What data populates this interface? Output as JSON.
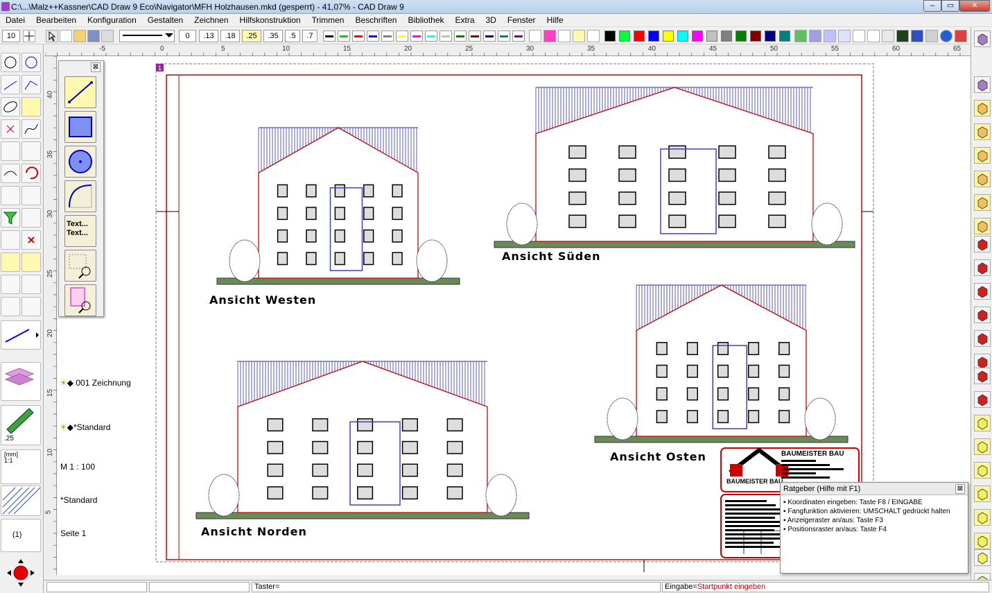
{
  "window": {
    "title": "C:\\...\\Malz++Kassner\\CAD Draw 9 Eco\\Navigator\\MFH Holzhausen.mkd (gesperrt) - 41,07% - CAD Draw 9"
  },
  "menu": [
    "Datei",
    "Bearbeiten",
    "Konfiguration",
    "Gestalten",
    "Zeichnen",
    "Hilfskonstruktion",
    "Trimmen",
    "Beschriften",
    "Bibliothek",
    "Extra",
    "3D",
    "Fenster",
    "Hilfe"
  ],
  "toolbar": {
    "grid_value": "10",
    "line_widths": [
      "0",
      ".13",
      ".18",
      ".25",
      ".35",
      ".5",
      ".7"
    ],
    "colors": [
      "#000000",
      "#00d000",
      "#ff0000",
      "#0000ff",
      "#808080",
      "#ffff00",
      "#ff00ff",
      "#00ffff",
      "#008000",
      "#800000",
      "#000080",
      "#008080"
    ]
  },
  "ruler": {
    "h": [
      "-5",
      "0",
      "5",
      "10",
      "15",
      "20",
      "25",
      "30",
      "35",
      "40",
      "45",
      "50",
      "55",
      "60",
      "65"
    ],
    "v": [
      "40",
      "35",
      "30",
      "25",
      "20",
      "15",
      "10",
      "5"
    ]
  },
  "flyout": {
    "text_tool": "Text...\nText..."
  },
  "side": {
    "layer": "001 Zeichnung",
    "style": "*Standard",
    "scale": "M 1 : 100",
    "style2": "*Standard",
    "page": "Seite 1",
    "pen_width": ".25",
    "page_btn": "(1)",
    "ratio": "[mm]\n1:1"
  },
  "drawing": {
    "page_marker": "1",
    "views": [
      "Ansicht Westen",
      "Ansicht Süden",
      "Ansicht Norden",
      "Ansicht Osten"
    ],
    "company": "BAUMEISTER BAU"
  },
  "ratgeber": {
    "title": "Ratgeber (Hilfe mit F1)",
    "items": [
      "Koordinaten eingeben: Taste F8 / EINGABE",
      "Fangfunktion aktivieren: UMSCHALT gedrückt halten",
      "Anzeigeraster an/aus: Taste F3",
      "Positionsraster an/aus: Taste F4"
    ]
  },
  "status": {
    "taster": "Taster=",
    "eingabe_label": "Eingabe=",
    "eingabe_value": "Startpunkt eingeben"
  }
}
